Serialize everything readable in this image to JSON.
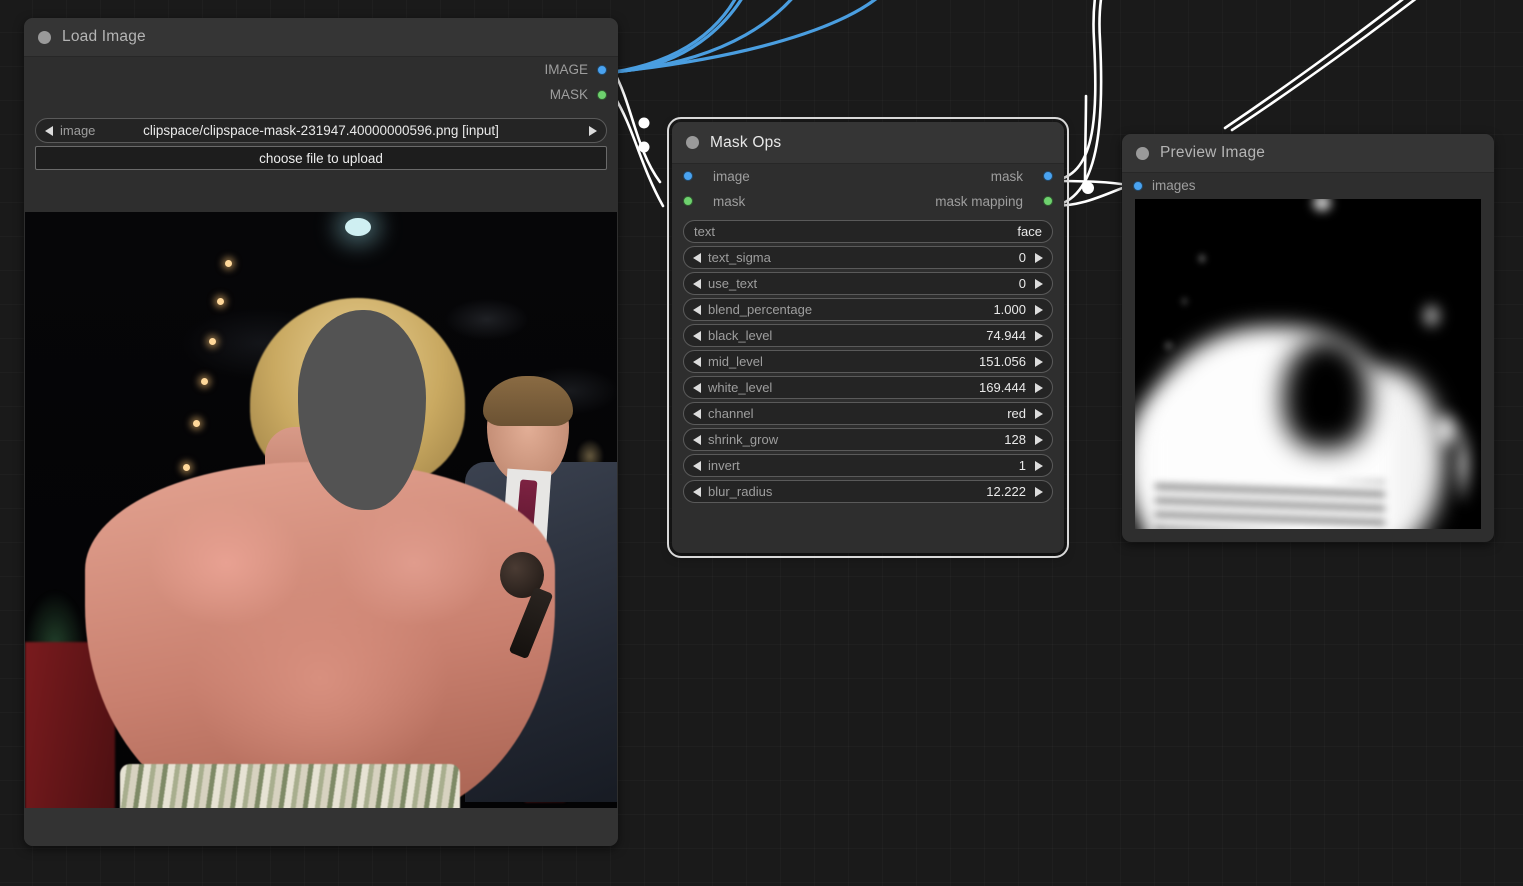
{
  "canvas": {
    "background_color": "#1a1a1a",
    "grid_color": "#242424"
  },
  "colors": {
    "image_port": "#4aa3f0",
    "mask_port": "#6ed16e",
    "link_image": "#4a9ee0",
    "link_mask": "#ffffff",
    "node_header": "#353535",
    "node_body": "#2e2e2e",
    "widget_fill": "#242424",
    "selection_outline": "#d8d8d8"
  },
  "nodes": {
    "load_image": {
      "title": "Load Image",
      "collapse_icon": "collapse-dot-icon",
      "outputs": [
        {
          "label": "IMAGE",
          "type": "IMAGE",
          "color": "#4aa3f0"
        },
        {
          "label": "MASK",
          "type": "MASK",
          "color": "#6ed16e"
        }
      ],
      "widgets": [
        {
          "name": "image",
          "kind": "combo",
          "label": "image",
          "value": "clipspace/clipspace-mask-231947.40000000596.png [input]",
          "left_arrow": "◀",
          "right_arrow": "▶"
        },
        {
          "name": "upload",
          "kind": "button",
          "label": "choose file to upload"
        }
      ],
      "preview_alt": "Wrestler with blonde hair, face covered by gray mask blob, interviewer in suit holding microphone, dark arena crowd"
    },
    "mask_ops": {
      "title": "Mask Ops",
      "collapse_icon": "collapse-dot-icon",
      "selected": true,
      "inputs": [
        {
          "label": "image",
          "type": "IMAGE",
          "color": "#4aa3f0"
        },
        {
          "label": "mask",
          "type": "MASK",
          "color": "#6ed16e"
        }
      ],
      "outputs": [
        {
          "label": "mask",
          "type": "MASK",
          "color": "#4aa3f0"
        },
        {
          "label": "mask mapping",
          "type": "MASK_MAPPING",
          "color": "#6ed16e"
        }
      ],
      "widgets": [
        {
          "name": "text",
          "kind": "text",
          "label": "text",
          "value": "face"
        },
        {
          "name": "text_sigma",
          "kind": "number",
          "label": "text_sigma",
          "value": "0"
        },
        {
          "name": "use_text",
          "kind": "number",
          "label": "use_text",
          "value": "0"
        },
        {
          "name": "blend_percentage",
          "kind": "number",
          "label": "blend_percentage",
          "value": "1.000"
        },
        {
          "name": "black_level",
          "kind": "number",
          "label": "black_level",
          "value": "74.944"
        },
        {
          "name": "mid_level",
          "kind": "number",
          "label": "mid_level",
          "value": "151.056"
        },
        {
          "name": "white_level",
          "kind": "number",
          "label": "white_level",
          "value": "169.444"
        },
        {
          "name": "channel",
          "kind": "combo",
          "label": "channel",
          "value": "red"
        },
        {
          "name": "shrink_grow",
          "kind": "number",
          "label": "shrink_grow",
          "value": "128"
        },
        {
          "name": "invert",
          "kind": "number",
          "label": "invert",
          "value": "1"
        },
        {
          "name": "blur_radius",
          "kind": "number",
          "label": "blur_radius",
          "value": "12.222"
        }
      ],
      "arrows": {
        "left": "◀",
        "right": "▶"
      }
    },
    "preview_image": {
      "title": "Preview Image",
      "collapse_icon": "collapse-dot-icon",
      "inputs": [
        {
          "label": "images",
          "type": "IMAGE",
          "color": "#4aa3f0"
        }
      ],
      "preview_alt": "Blurred grayscale mask of a torso silhouette on black background"
    }
  },
  "links": [
    {
      "from": "load_image.IMAGE",
      "to": "mask_ops.image",
      "color": "#ffffff"
    },
    {
      "from": "load_image.MASK",
      "to": "mask_ops.mask",
      "color": "#ffffff"
    },
    {
      "from": "load_image.IMAGE",
      "to": "offscreen_top",
      "color": "#4a9ee0"
    },
    {
      "from": "mask_ops.mask",
      "to": "preview_image.images",
      "color": "#ffffff"
    },
    {
      "from": "mask_ops.mask_mapping",
      "to": "preview_image.images",
      "color": "#ffffff"
    }
  ]
}
